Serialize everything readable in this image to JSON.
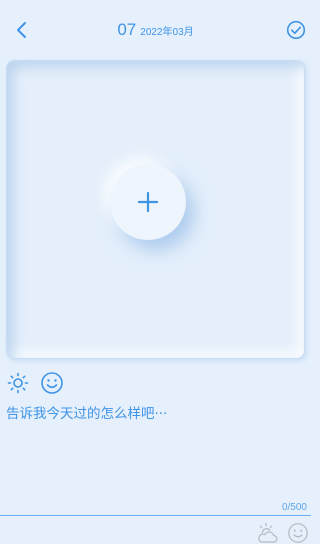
{
  "header": {
    "day": "07",
    "year_month": "2022年03月",
    "back_icon": "chevron-left-icon",
    "done_icon": "check-circle-icon"
  },
  "photo": {
    "add_icon": "plus-icon"
  },
  "tools": {
    "weather_icon": "sun-icon",
    "mood_icon": "smiley-icon"
  },
  "content": {
    "placeholder": "告诉我今天过的怎么样吧···",
    "value": ""
  },
  "counter": {
    "text": "0/500",
    "current": 0,
    "max": 500
  },
  "bottom_bar": {
    "weather_icon": "cloud-sun-icon",
    "mood_icon": "smiley-icon"
  },
  "colors": {
    "background": "#e5f0fc",
    "accent": "#3f94e6",
    "divider": "#6fb0ec",
    "muted_icon": "#b4b9c0"
  }
}
